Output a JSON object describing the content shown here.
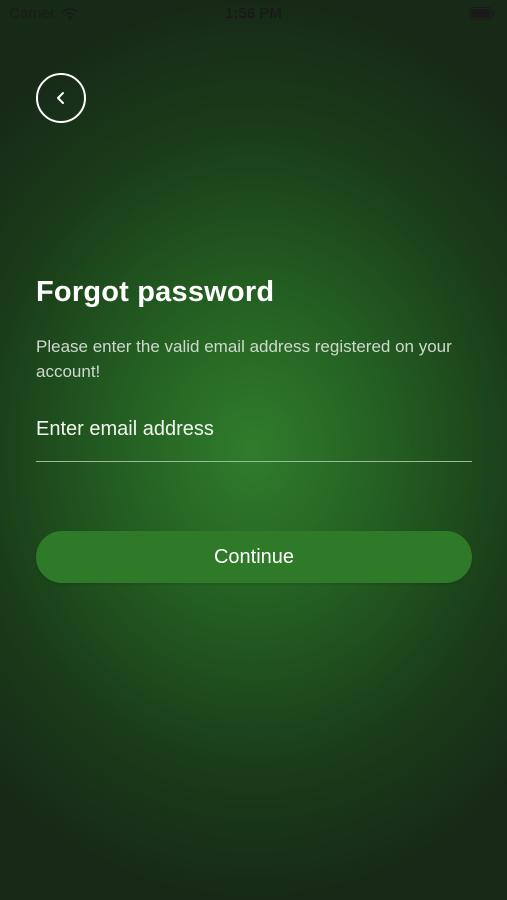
{
  "status_bar": {
    "carrier": "Carrier",
    "time": "1:56 PM"
  },
  "header": {
    "back_icon": "chevron-left-icon"
  },
  "main": {
    "title": "Forgot password",
    "description": "Please enter the valid email address registered on your account!",
    "email_placeholder": "Enter email address",
    "email_value": "",
    "continue_label": "Continue"
  },
  "colors": {
    "background_center": "#2f7d2c",
    "background_edge": "#172a17",
    "button": "#2f7a29",
    "text": "#ffffff"
  }
}
